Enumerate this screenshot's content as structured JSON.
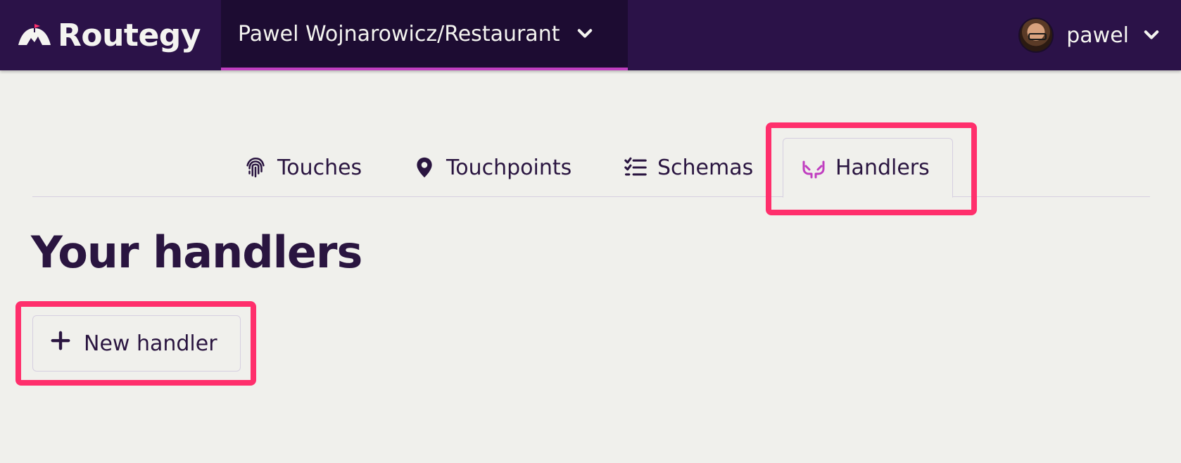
{
  "brand": {
    "name": "Routegy",
    "logo_icon": "mountain-flag-icon"
  },
  "project_selector": {
    "label": "Pawel Wojnarowicz/Restaurant",
    "icon": "chevron-down-icon"
  },
  "user_menu": {
    "username": "pawel",
    "icon": "chevron-down-icon"
  },
  "tabs": [
    {
      "label": "Touches",
      "icon": "fingerprint-icon",
      "active": false
    },
    {
      "label": "Touchpoints",
      "icon": "map-pin-icon",
      "active": false
    },
    {
      "label": "Schemas",
      "icon": "checklist-icon",
      "active": false
    },
    {
      "label": "Handlers",
      "icon": "hands-icon",
      "active": true
    }
  ],
  "page": {
    "title": "Your handlers",
    "new_button_label": "New handler",
    "new_button_icon": "plus-icon"
  },
  "colors": {
    "topbar": "#2b1248",
    "project_bg": "#1d0c32",
    "accent": "#c03ec0",
    "highlight": "#ff2f6c",
    "text": "#2a1540",
    "background": "#f0f0ec"
  }
}
